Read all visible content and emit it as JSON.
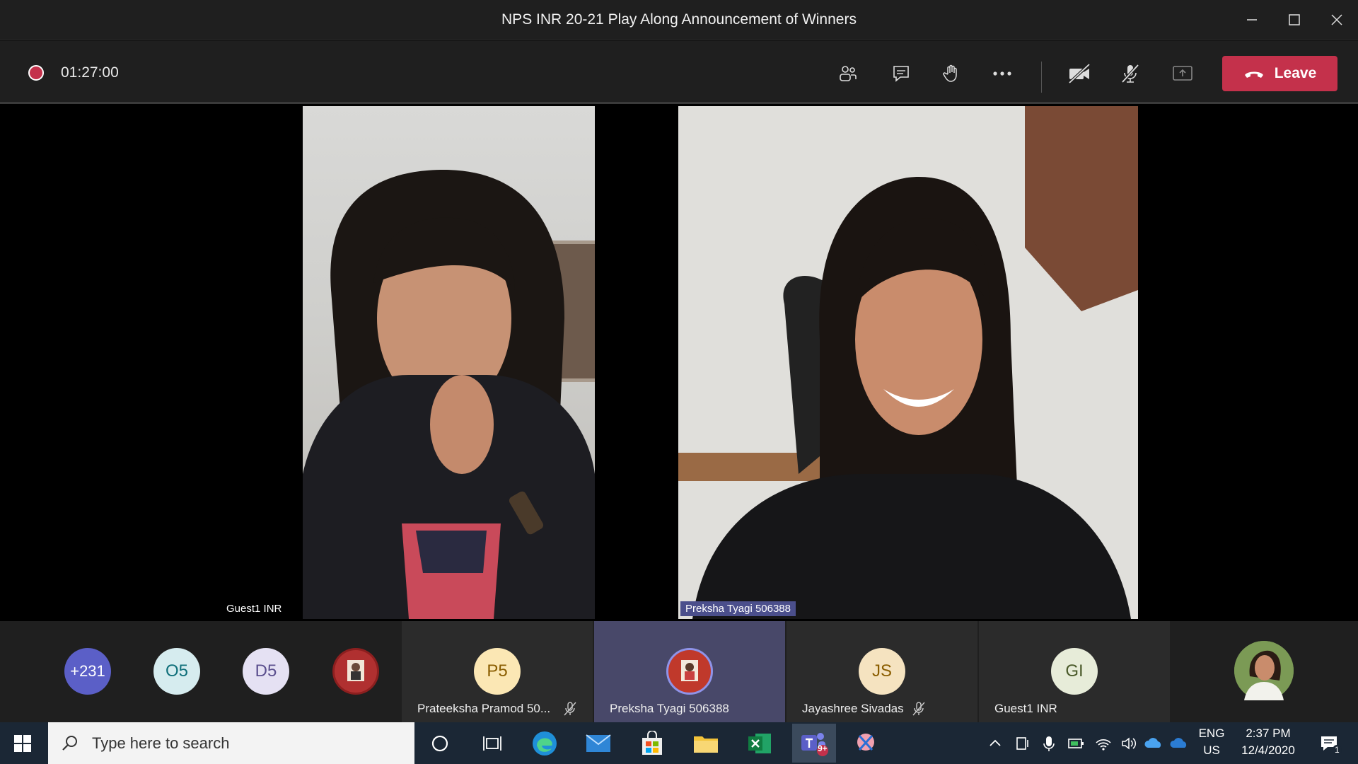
{
  "window": {
    "title": "NPS INR 20-21 Play Along Announcement of Winners",
    "controls": [
      "minimize-icon",
      "maximize-icon",
      "close-icon"
    ]
  },
  "toolbar": {
    "timer": "01:27:00",
    "buttons": [
      "participants-icon",
      "chat-icon",
      "raise-hand-icon",
      "more-options-icon",
      "camera-off-icon",
      "mic-off-icon",
      "share-icon"
    ],
    "leave_label": "Leave",
    "leave_color": "#c4314b"
  },
  "stage": {
    "videos": [
      {
        "name": "Guest1 INR"
      },
      {
        "name": "Preksha Tyagi 506388"
      }
    ]
  },
  "roster": {
    "overflow_label": "+231",
    "avatars": [
      {
        "initials": "O5",
        "color": "#d6ecef"
      },
      {
        "initials": "D5",
        "color": "#e5e1f3"
      }
    ],
    "tiles": [
      {
        "initials": "P5",
        "name": "Prateeksha Pramod 50...",
        "color": "#fbe7b4",
        "muted": true
      },
      {
        "initials": "",
        "name": "Preksha Tyagi 506388",
        "color": "#c0392b",
        "muted": false,
        "active": true
      },
      {
        "initials": "JS",
        "name": "Jayashree Sivadas",
        "color": "#f5e3c0",
        "muted": true
      },
      {
        "initials": "GI",
        "name": "Guest1 INR",
        "color": "#e7ecd9",
        "muted": false
      }
    ]
  },
  "taskbar": {
    "search_placeholder": "Type here to search",
    "lang_top": "ENG",
    "lang_bottom": "US",
    "time": "2:37 PM",
    "date": "12/4/2020",
    "teams_badge": "9+",
    "notification_count": "1"
  }
}
